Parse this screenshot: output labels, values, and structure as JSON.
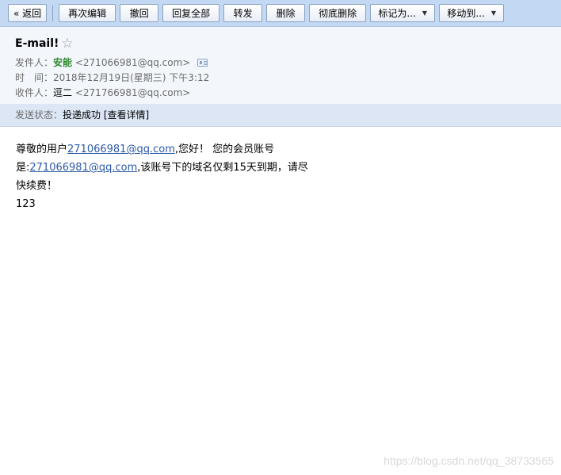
{
  "toolbar": {
    "back": "« 返回",
    "re_edit": "再次编辑",
    "recall": "撤回",
    "reply_all": "回复全部",
    "forward": "转发",
    "delete": "删除",
    "delete_forever": "彻底删除",
    "mark_as": "标记为...",
    "move_to": "移动到..."
  },
  "header": {
    "subject": "E-mail!",
    "from_label": "发件人：",
    "from_name": "安能",
    "from_addr": "<271066981@qq.com>",
    "time_label": "时　间：",
    "time_value": "2018年12月19日(星期三) 下午3:12",
    "to_label": "收件人：",
    "to_name": "逗二",
    "to_addr": "<271766981@qq.com>"
  },
  "status": {
    "label": "发送状态：",
    "value": "投递成功",
    "details_link": "[查看详情]"
  },
  "body": {
    "line1_pre": "尊敬的用户",
    "line1_link": "271066981@qq.com",
    "line1_post": ",您好！ 您的会员账号",
    "line2_pre": "是:",
    "line2_link": "271066981@qq.com",
    "line2_post": ",该账号下的域名仅剩15天到期，请尽",
    "line3": "快续费！",
    "line4": "123"
  },
  "watermark": "https://blog.csdn.net/qq_38733565",
  "colors": {
    "toolbar_bg": "#c3d9f3",
    "header_bg": "#f3f7fc",
    "status_bg": "#dce6f5",
    "sender_name": "#2e8b2e",
    "link": "#2b5aa8"
  },
  "icons": {
    "star": "star-outline-icon",
    "contact_card": "contact-card-icon",
    "dropdown": "caret-down-icon"
  }
}
